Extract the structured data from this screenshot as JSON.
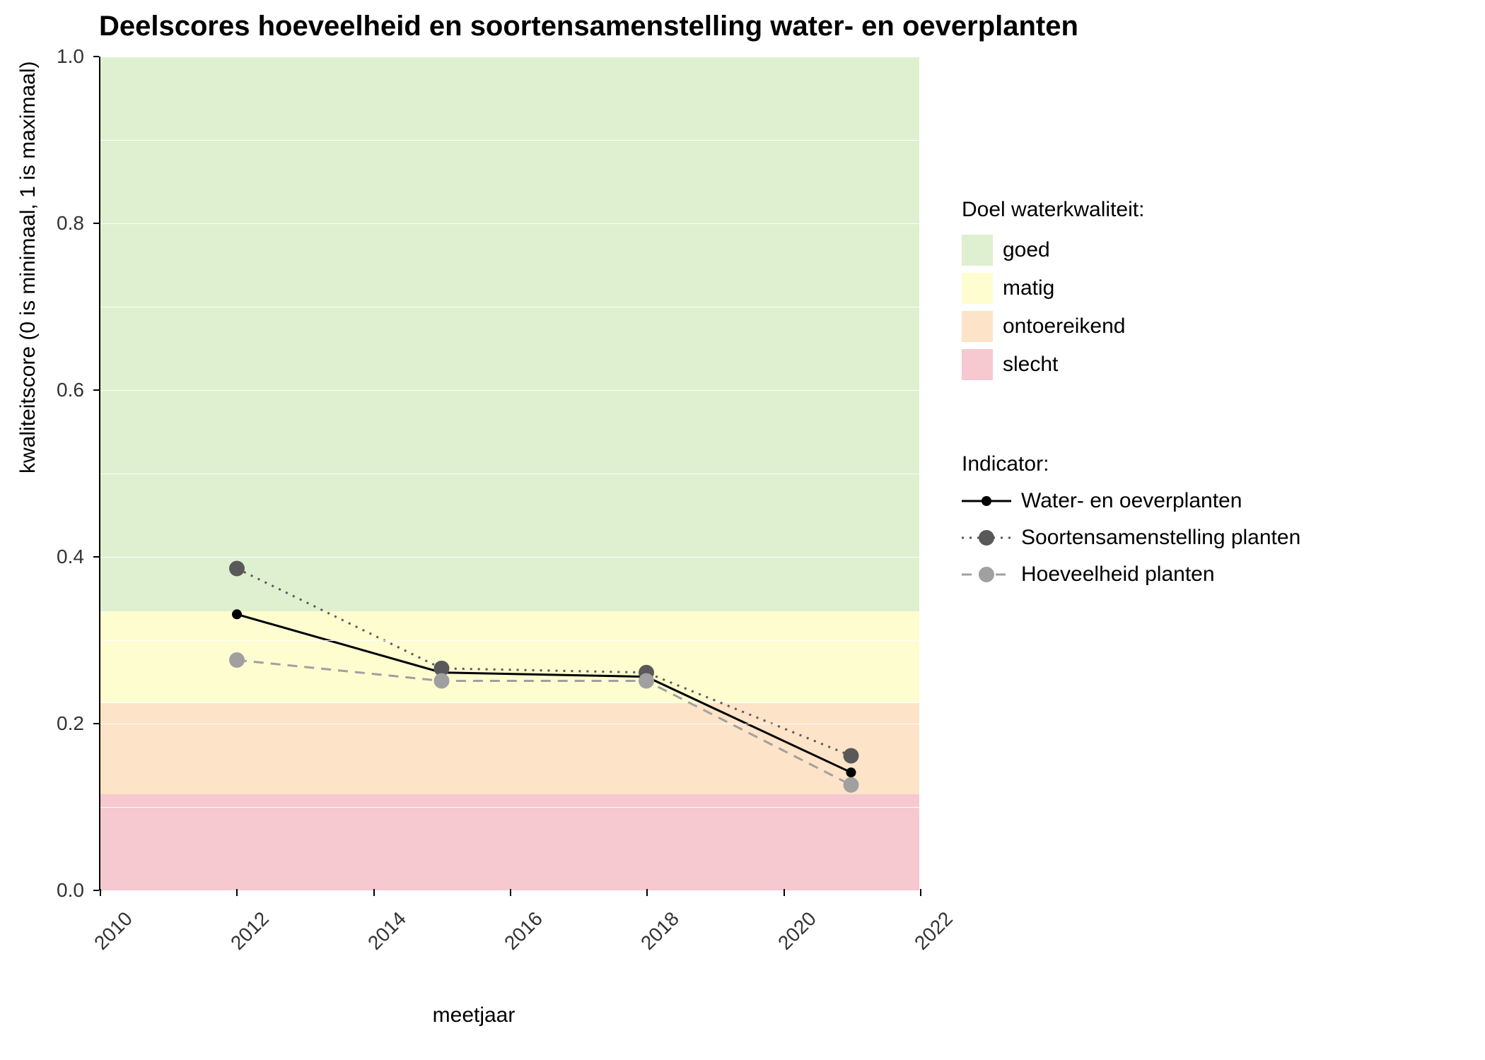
{
  "chart_data": {
    "type": "line",
    "title": "Deelscores hoeveelheid en soortensamenstelling water- en oeverplanten",
    "xlabel": "meetjaar",
    "ylabel": "kwaliteitscore (0 is minimaal, 1 is maximaal)",
    "x": [
      2012,
      2015,
      2018,
      2021
    ],
    "x_ticks": [
      2010,
      2012,
      2014,
      2016,
      2018,
      2020,
      2022
    ],
    "y_ticks": [
      0.0,
      0.2,
      0.4,
      0.6,
      0.8,
      1.0
    ],
    "xlim": [
      2010,
      2022
    ],
    "ylim": [
      0,
      1
    ],
    "series": [
      {
        "name": "Water- en oeverplanten",
        "values": [
          0.33,
          0.26,
          0.255,
          0.14
        ],
        "color": "#000000",
        "linestyle": "solid",
        "marker_size": 7
      },
      {
        "name": "Soortensamenstelling planten",
        "values": [
          0.385,
          0.265,
          0.26,
          0.16
        ],
        "color": "#595959",
        "linestyle": "dotted",
        "marker_size": 11
      },
      {
        "name": "Hoeveelheid planten",
        "values": [
          0.275,
          0.25,
          0.25,
          0.125
        ],
        "color": "#A0A0A0",
        "linestyle": "dashed",
        "marker_size": 11
      }
    ],
    "bands": [
      {
        "name": "goed",
        "from": 0.335,
        "to": 1.0,
        "color": "#dff0d0"
      },
      {
        "name": "matig",
        "from": 0.225,
        "to": 0.335,
        "color": "#fdfdd0"
      },
      {
        "name": "ontoereikend",
        "from": 0.115,
        "to": 0.225,
        "color": "#fde3c8"
      },
      {
        "name": "slecht",
        "from": 0.0,
        "to": 0.115,
        "color": "#f6c8d0"
      }
    ],
    "legend_band_title": "Doel waterkwaliteit:",
    "legend_series_title": "Indicator:"
  }
}
